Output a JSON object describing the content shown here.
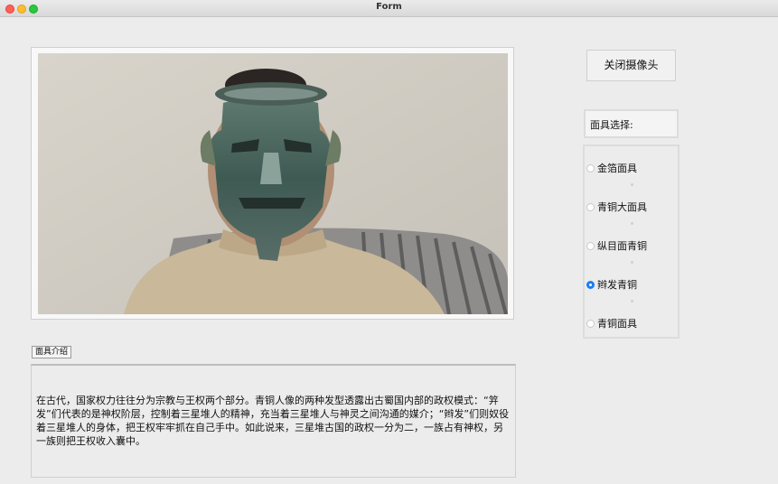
{
  "window": {
    "title": "Form"
  },
  "camera_button": {
    "label": "关闭摄像头"
  },
  "mask_select": {
    "label": "面具选择:"
  },
  "mask_options": [
    {
      "label": "金箔面具",
      "checked": false
    },
    {
      "label": "青铜大面具",
      "checked": false
    },
    {
      "label": "纵目面青铜",
      "checked": false
    },
    {
      "label": "辫发青铜",
      "checked": true
    },
    {
      "label": "青铜面具",
      "checked": false
    }
  ],
  "intro": {
    "button_label": "面具介绍",
    "text": "在古代，国家权力往往分为宗教与王权两个部分。青铜人像的两种发型透露出古蜀国内部的政权模式：“笄发”们代表的是神权阶层，控制着三星堆人的精神，充当着三星堆人与神灵之间沟通的媒介；“辫发”们则奴役着三星堆人的身体，把王权牢牢抓在自己手中。如此说来，三星堆古国的政权一分为二，一族占有神权，另一族则把王权收入囊中。"
  }
}
